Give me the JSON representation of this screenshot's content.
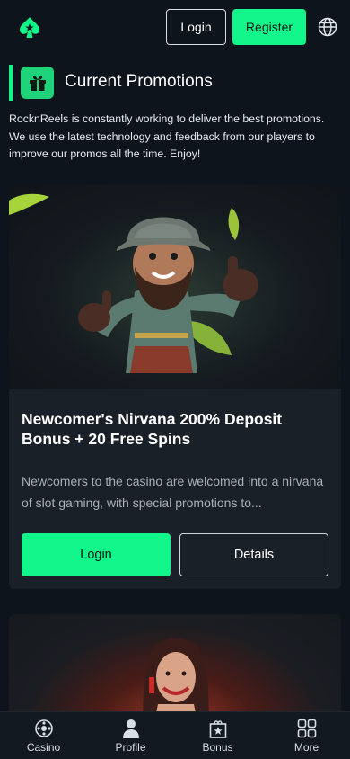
{
  "header": {
    "login_label": "Login",
    "register_label": "Register"
  },
  "section": {
    "title": "Current Promotions",
    "intro": "RocknReels is constantly working to deliver the best promotions. We use the latest technology and feedback from our players to improve our promos all the time. Enjoy!"
  },
  "promo_card": {
    "title": "Newcomer's Nirvana 200% Deposit Bonus + 20 Free Spins",
    "description": "Newcomers to the casino are welcomed into a nirvana of slot gaming, with special promotions to...",
    "login_label": "Login",
    "details_label": "Details"
  },
  "bottom_nav": {
    "items": [
      {
        "label": "Casino",
        "icon": "casino-chip-icon"
      },
      {
        "label": "Profile",
        "icon": "profile-icon"
      },
      {
        "label": "Bonus",
        "icon": "bonus-star-icon"
      },
      {
        "label": "More",
        "icon": "grid-icon"
      }
    ]
  },
  "colors": {
    "accent": "#12f58a",
    "background": "#0d141b",
    "card": "#1a2027"
  }
}
